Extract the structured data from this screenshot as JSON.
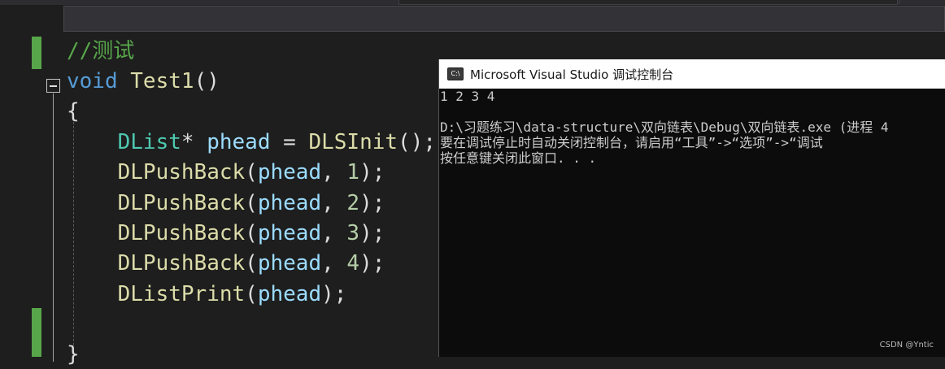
{
  "editor": {
    "code_lines": [
      {
        "tokens": [
          {
            "t": "//测试",
            "c": "cmt"
          }
        ]
      },
      {
        "tokens": [
          {
            "t": "void",
            "c": "kw"
          },
          {
            "t": " ",
            "c": "pl"
          },
          {
            "t": "Test1",
            "c": "fn"
          },
          {
            "t": "()",
            "c": "pl"
          }
        ]
      },
      {
        "tokens": [
          {
            "t": "{",
            "c": "pl"
          }
        ]
      },
      {
        "tokens": [
          {
            "t": "    ",
            "c": "pl"
          },
          {
            "t": "DList",
            "c": "ty"
          },
          {
            "t": "* ",
            "c": "pl"
          },
          {
            "t": "phead",
            "c": "var"
          },
          {
            "t": " = ",
            "c": "pl"
          },
          {
            "t": "DLSInit",
            "c": "fn"
          },
          {
            "t": "();",
            "c": "pl"
          }
        ]
      },
      {
        "tokens": [
          {
            "t": "    ",
            "c": "pl"
          },
          {
            "t": "DLPushBack",
            "c": "fn"
          },
          {
            "t": "(",
            "c": "pl"
          },
          {
            "t": "phead",
            "c": "var"
          },
          {
            "t": ", ",
            "c": "pl"
          },
          {
            "t": "1",
            "c": "num"
          },
          {
            "t": ");",
            "c": "pl"
          }
        ]
      },
      {
        "tokens": [
          {
            "t": "    ",
            "c": "pl"
          },
          {
            "t": "DLPushBack",
            "c": "fn"
          },
          {
            "t": "(",
            "c": "pl"
          },
          {
            "t": "phead",
            "c": "var"
          },
          {
            "t": ", ",
            "c": "pl"
          },
          {
            "t": "2",
            "c": "num"
          },
          {
            "t": ");",
            "c": "pl"
          }
        ]
      },
      {
        "tokens": [
          {
            "t": "    ",
            "c": "pl"
          },
          {
            "t": "DLPushBack",
            "c": "fn"
          },
          {
            "t": "(",
            "c": "pl"
          },
          {
            "t": "phead",
            "c": "var"
          },
          {
            "t": ", ",
            "c": "pl"
          },
          {
            "t": "3",
            "c": "num"
          },
          {
            "t": ");",
            "c": "pl"
          }
        ]
      },
      {
        "tokens": [
          {
            "t": "    ",
            "c": "pl"
          },
          {
            "t": "DLPushBack",
            "c": "fn"
          },
          {
            "t": "(",
            "c": "pl"
          },
          {
            "t": "phead",
            "c": "var"
          },
          {
            "t": ", ",
            "c": "pl"
          },
          {
            "t": "4",
            "c": "num"
          },
          {
            "t": ");",
            "c": "pl"
          }
        ]
      },
      {
        "tokens": [
          {
            "t": "    ",
            "c": "pl"
          },
          {
            "t": "DListPrint",
            "c": "fn"
          },
          {
            "t": "(",
            "c": "pl"
          },
          {
            "t": "phead",
            "c": "var"
          },
          {
            "t": ");",
            "c": "pl"
          }
        ]
      },
      {
        "tokens": []
      },
      {
        "tokens": [
          {
            "t": "}",
            "c": "pl"
          }
        ]
      }
    ]
  },
  "console": {
    "title": "Microsoft Visual Studio 调试控制台",
    "icon_label": "C:\\",
    "lines": [
      "1 2 3 4",
      "",
      "D:\\习题练习\\data-structure\\双向链表\\Debug\\双向链表.exe (进程 4",
      "要在调试停止时自动关闭控制台，请启用“工具”->“选项”->“调试",
      "按任意键关闭此窗口. . ."
    ]
  },
  "watermark": "CSDN @Yntic",
  "colors": {
    "editor_bg": "#1e1e1e",
    "comment": "#57a64a",
    "keyword": "#569cd6",
    "function": "#dcdcaa",
    "type": "#4ec9b0",
    "variable": "#9cdcfe",
    "number": "#b5cea8",
    "console_bg": "#0c0c0c",
    "console_text": "#cccccc"
  }
}
